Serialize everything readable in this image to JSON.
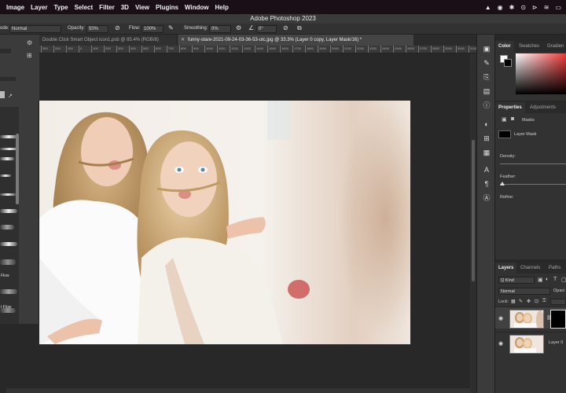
{
  "menubar": {
    "items": [
      "Image",
      "Layer",
      "Type",
      "Select",
      "Filter",
      "3D",
      "View",
      "Plugins",
      "Window",
      "Help"
    ]
  },
  "window": {
    "title": "Adobe Photoshop 2023"
  },
  "options": {
    "mode_label": "ode:",
    "mode_value": "Normal",
    "opacity_label": "Opacity:",
    "opacity_value": "50%",
    "flow_label": "Flow:",
    "flow_value": "100%",
    "smoothing_label": "Smoothing:",
    "smoothing_value": "0%",
    "angle_value": "0°"
  },
  "brush_panel": {
    "labels": [
      "Flow",
      "t Flow"
    ]
  },
  "tabs": [
    {
      "label": "Double Click Smart Object icon1.psb @ 85.4% (RGB/8)"
    },
    {
      "label": "funny-stare-2021-09-24-03-36-53-utc.jpg @ 33.3% (Layer 0 copy, Layer Mask/16) *"
    }
  ],
  "ruler": {
    "ticks": [
      "300",
      "200",
      "100",
      "0",
      "100",
      "200",
      "300",
      "400",
      "500",
      "600",
      "700",
      "800",
      "900",
      "1000",
      "1100",
      "1200",
      "1300",
      "1400",
      "1500",
      "1600",
      "1700",
      "1800",
      "1900",
      "2000",
      "2100",
      "2200",
      "2300",
      "2400",
      "2500",
      "2600",
      "2700",
      "2800",
      "2900",
      "3000",
      "3100",
      "3200"
    ]
  },
  "color_panel": {
    "tabs": [
      "Color",
      "Swatches",
      "Gradien"
    ]
  },
  "properties_panel": {
    "tabs": [
      "Properties",
      "Adjustments"
    ],
    "masks_label": "Masks",
    "layer_mask_label": "Layer Mask",
    "density_label": "Density:",
    "feather_label": "Feather:",
    "refine_label": "Refine:"
  },
  "layers_panel": {
    "tabs": [
      "Layers",
      "Channels",
      "Paths"
    ],
    "kind_label": "Q Kind",
    "blend_mode": "Normal",
    "opacity_label": "Opaci",
    "lock_label": "Lock:",
    "layers": [
      {
        "name": ""
      },
      {
        "name": "Layer 0"
      }
    ]
  },
  "colors": {
    "menubar_bg": "#1a0f17",
    "panel_bg": "#323232",
    "canvas_bg": "#282828"
  }
}
